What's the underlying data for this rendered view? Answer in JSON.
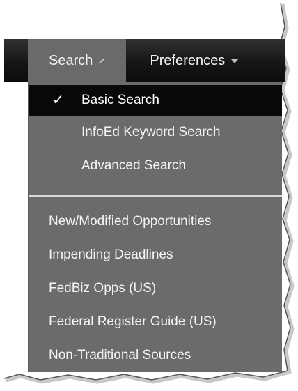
{
  "nav": {
    "search_label": "Search",
    "preferences_label": "Preferences"
  },
  "menu": {
    "search_types": [
      {
        "label": "Basic Search",
        "selected": true
      },
      {
        "label": "InfoEd Keyword Search",
        "selected": false
      },
      {
        "label": "Advanced Search",
        "selected": false
      }
    ],
    "sources": [
      {
        "label": "New/Modified Opportunities"
      },
      {
        "label": "Impending Deadlines"
      },
      {
        "label": "FedBiz Opps (US)"
      },
      {
        "label": "Federal Register Guide (US)"
      },
      {
        "label": "Non-Traditional Sources"
      }
    ],
    "check_glyph": "✓"
  },
  "colors": {
    "navbar": "#111111",
    "active_tab": "#6a6a6a",
    "menu_background": "#6b6b6b",
    "selected_item": "#080808",
    "divider": "#dadada"
  },
  "icons": {
    "search_caret": "chevron-down-icon",
    "preferences_caret": "chevron-down-icon",
    "selected_marker": "checkmark-icon"
  }
}
